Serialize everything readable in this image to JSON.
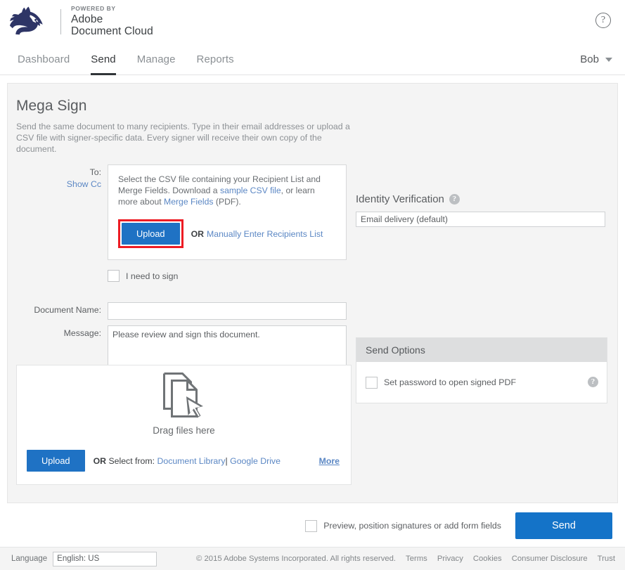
{
  "header": {
    "logo_icon": "husky-logo",
    "powered_by": "POWERED BY",
    "brand_line1": "Adobe",
    "brand_line2": "Document Cloud",
    "help_icon": "?"
  },
  "nav": {
    "items": [
      {
        "label": "Dashboard",
        "active": false
      },
      {
        "label": "Send",
        "active": true
      },
      {
        "label": "Manage",
        "active": false
      },
      {
        "label": "Reports",
        "active": false
      }
    ],
    "user": "Bob",
    "user_caret_icon": "caret-down-icon"
  },
  "main": {
    "title": "Mega Sign",
    "description": "Send the same document to many recipients. Type in their email addresses or upload a CSV file with signer-specific data. Every signer will receive their own copy of the document.",
    "to_label": "To:",
    "show_cc_label": "Show Cc",
    "csv": {
      "text_part1": "Select the CSV file containing your Recipient List and Merge Fields. Download a ",
      "link_sample": "sample CSV file",
      "text_part2": ", or learn more about ",
      "link_merge": "Merge Fields",
      "text_part3": " (PDF).",
      "upload_label": "Upload",
      "or_label": "OR",
      "manual_link": "Manually Enter Recipients List",
      "highlight_color": "#ed1c24"
    },
    "i_need_to_sign": "I need to sign",
    "document_name_label": "Document Name:",
    "document_name_value": "",
    "document_name_placeholder": "",
    "message_label": "Message:",
    "message_value": "Please review and sign this document.",
    "language_label": "Language:",
    "language_value": "English: US",
    "dropzone": {
      "icon": "documents-drag-icon",
      "caption": "Drag files here",
      "upload_label": "Upload",
      "or_label": "OR",
      "select_from_label": "Select from:",
      "link_library": "Document Library",
      "separator": "|",
      "link_gdrive": "Google Drive",
      "more_label": "More"
    }
  },
  "right": {
    "identity_title": "Identity Verification",
    "identity_help_icon": "?",
    "identity_value": "Email delivery (default)",
    "send_options_title": "Send Options",
    "set_password_label": "Set password to open signed PDF",
    "send_options_help_icon": "?"
  },
  "actionbar": {
    "preview_label": "Preview, position signatures or add form fields",
    "send_label": "Send",
    "send_color": "#1473c8"
  },
  "footer": {
    "language_label": "Language",
    "language_value": "English: US",
    "copyright": "© 2015 Adobe Systems Incorporated. All rights reserved.",
    "links": [
      "Terms",
      "Privacy",
      "Cookies",
      "Consumer Disclosure",
      "Trust"
    ]
  }
}
